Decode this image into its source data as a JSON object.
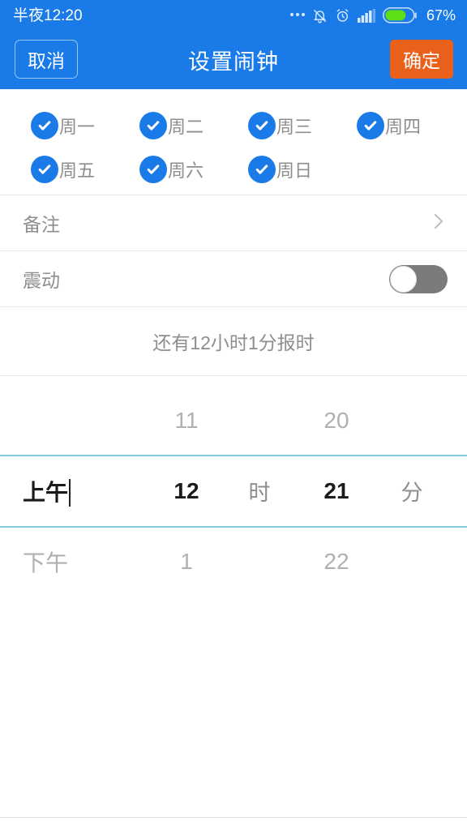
{
  "status_bar": {
    "time": "半夜12:20",
    "battery_percent": "67%",
    "icons": [
      "more-dots-icon",
      "bell-muted-icon",
      "alarm-clock-icon",
      "signal-bars-icon",
      "battery-icon"
    ]
  },
  "header": {
    "cancel_label": "取消",
    "title": "设置闹钟",
    "confirm_label": "确定",
    "bar_color": "#1a7ae8",
    "confirm_color": "#e8601a"
  },
  "weekdays": {
    "row1": [
      {
        "label": "周一",
        "checked": true
      },
      {
        "label": "周二",
        "checked": true
      },
      {
        "label": "周三",
        "checked": true
      },
      {
        "label": "周四",
        "checked": true
      }
    ],
    "row2": [
      {
        "label": "周五",
        "checked": true
      },
      {
        "label": "周六",
        "checked": true
      },
      {
        "label": "周日",
        "checked": true
      }
    ],
    "check_color": "#1a7ae8"
  },
  "rows": {
    "remark": {
      "label": "备注",
      "value": "",
      "chevron": "chevron-right-icon"
    },
    "vibrate": {
      "label": "震动",
      "enabled": false
    }
  },
  "countdown": {
    "text": "还有12小时1分报时"
  },
  "picker": {
    "above": {
      "ampm": "",
      "hour": "11",
      "hour_unit": "",
      "minute": "20",
      "minute_unit": ""
    },
    "selected": {
      "ampm": "上午",
      "hour": "12",
      "hour_unit": "时",
      "minute": "21",
      "minute_unit": "分"
    },
    "below": {
      "ampm": "下午",
      "hour": "1",
      "hour_unit": "",
      "minute": "22",
      "minute_unit": ""
    },
    "highlight_color": "#7ecbe2"
  }
}
